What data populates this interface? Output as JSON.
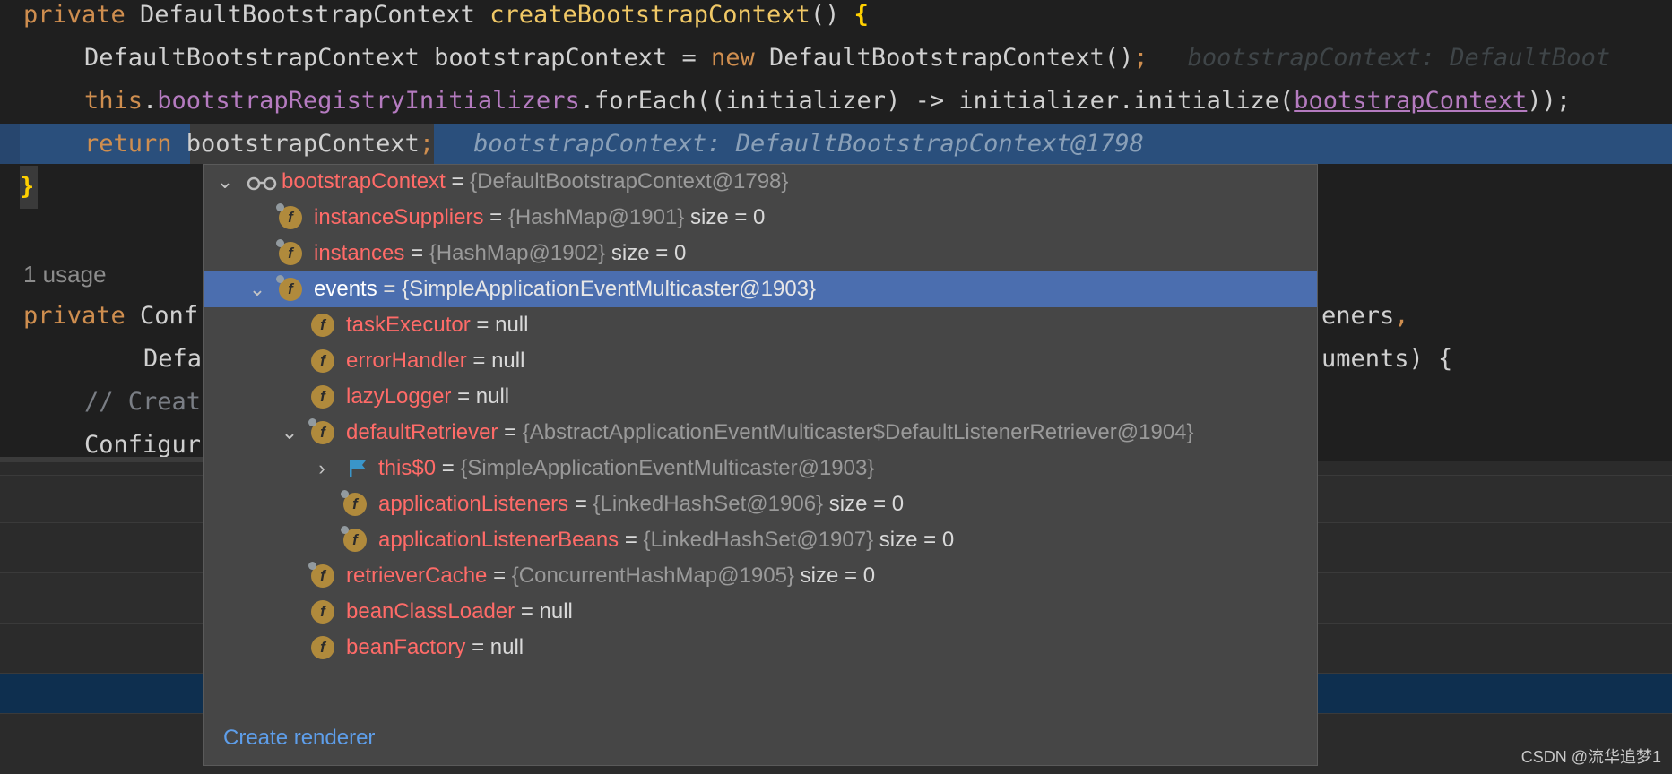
{
  "code": {
    "line1": {
      "kw": "private ",
      "type": "DefaultBootstrapContext ",
      "fn": "createBootstrapContext",
      "rest": "() ",
      "brace": "{"
    },
    "line2": {
      "a": "DefaultBootstrapContext bootstrapContext = ",
      "kw": "new",
      "b": " DefaultBootstrapContext()",
      "semi": ";",
      "hint": "bootstrapContext: DefaultBoot"
    },
    "line3": {
      "kw": "this",
      "dot": ".",
      "field": "bootstrapRegistryInitializers",
      "a": ".forEach((initializer) -> initializer.initialize(",
      "arg": "bootstrapContext",
      "b": "));"
    },
    "line4": {
      "kw": "return ",
      "var": "bootstrapContext",
      "semi": ";",
      "inline": "bootstrapContext: DefaultBootstrapContext@1798"
    },
    "line5": {
      "brace": "}"
    },
    "usage": "1 usage",
    "line7": {
      "kw": "private ",
      "a": "Conf",
      "right": "eners",
      "comma": ","
    },
    "line8": {
      "a": "Defa",
      "right": "uments) {"
    },
    "line9": {
      "comment": "// Creat"
    },
    "line10": {
      "a": "Configur"
    }
  },
  "popup": {
    "rows": [
      {
        "name": "bootstrapContext",
        "value": "{DefaultBootstrapContext@1798}",
        "extra": ""
      },
      {
        "name": "instanceSuppliers",
        "value": "{HashMap@1901}",
        "extra": "size = 0"
      },
      {
        "name": "instances",
        "value": "{HashMap@1902}",
        "extra": "size = 0"
      },
      {
        "name": "events",
        "value": "{SimpleApplicationEventMulticaster@1903}",
        "extra": ""
      },
      {
        "name": "taskExecutor",
        "value": "null",
        "extra": ""
      },
      {
        "name": "errorHandler",
        "value": "null",
        "extra": ""
      },
      {
        "name": "lazyLogger",
        "value": "null",
        "extra": ""
      },
      {
        "name": "defaultRetriever",
        "value": "{AbstractApplicationEventMulticaster$DefaultListenerRetriever@1904}",
        "extra": ""
      },
      {
        "name": "this$0",
        "value": "{SimpleApplicationEventMulticaster@1903}",
        "extra": ""
      },
      {
        "name": "applicationListeners",
        "value": "{LinkedHashSet@1906}",
        "extra": "size = 0"
      },
      {
        "name": "applicationListenerBeans",
        "value": "{LinkedHashSet@1907}",
        "extra": "size = 0"
      },
      {
        "name": "retrieverCache",
        "value": "{ConcurrentHashMap@1905}",
        "extra": "size = 0"
      },
      {
        "name": "beanClassLoader",
        "value": "null",
        "extra": ""
      },
      {
        "name": "beanFactory",
        "value": "null",
        "extra": ""
      }
    ],
    "eq": "=",
    "field_icon": "f",
    "create_renderer": "Create renderer"
  },
  "watermark": "CSDN @流华追梦1",
  "colors": {
    "selection": "#4b6eaf",
    "current_line": "#2a4f7c",
    "field_name": "#ff6b68",
    "link": "#5e9eea"
  }
}
